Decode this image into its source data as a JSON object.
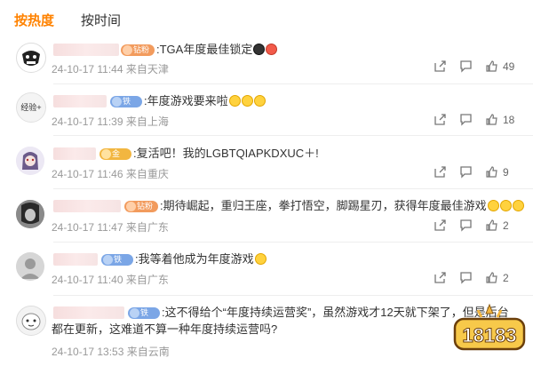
{
  "tabs": [
    {
      "label": "按热度",
      "active": true
    },
    {
      "label": "按时间",
      "active": false
    }
  ],
  "comments": [
    {
      "badge": "钻粉1",
      "badge_color": "#f29b5d",
      "text": ":TGA年度最佳锁定",
      "date": "24-10-17 11:44",
      "location": "来自天津",
      "likes": "49"
    },
    {
      "badge": "铁粉1",
      "badge_color": "#7ba6e6",
      "text": ":年度游戏要来啦",
      "date": "24-10-17 11:39",
      "location": "来自上海",
      "likes": "18"
    },
    {
      "badge": "金粉1",
      "badge_color": "#f2b640",
      "text": ":复活吧！我的LGBTQIAPKDXUC＋!",
      "date": "24-10-17 11:46",
      "location": "来自重庆",
      "likes": "9"
    },
    {
      "badge": "钻粉1",
      "badge_color": "#f29b5d",
      "text": ":期待崛起，重归王座，拳打悟空，脚踢星刃，获得年度最佳游戏",
      "date": "24-10-17 11:47",
      "location": "来自广东",
      "likes": "2"
    },
    {
      "badge": "铁粉5",
      "badge_color": "#7ba6e6",
      "text": ":我等着他成为年度游戏",
      "date": "24-10-17 11:40",
      "location": "来自广东",
      "likes": "2"
    },
    {
      "badge": "铁粉5",
      "badge_color": "#7ba6e6",
      "text": ":这不得给个“年度持续运营奖”，虽然游戏才12天就下架了，但是后台",
      "text2": "都在更新，这难道不算一种年度持续运营吗?",
      "date": "24-10-17 13:53",
      "location": "来自云南"
    }
  ],
  "avatar_text": "经验+",
  "watermark": "18183",
  "colors": {
    "accent": "#ff8200",
    "meta": "#999999"
  }
}
